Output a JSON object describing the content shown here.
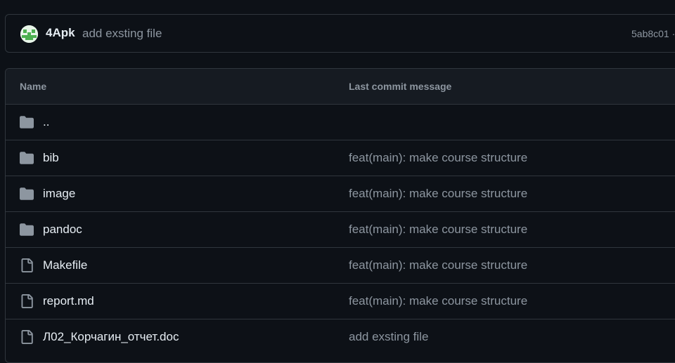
{
  "commit": {
    "author": "4Apk",
    "message": "add exsting file",
    "sha": "5ab8c01 ·"
  },
  "table": {
    "headers": {
      "name": "Name",
      "message": "Last commit message"
    },
    "rows": [
      {
        "type": "folder",
        "icon": "folder-icon",
        "name": "..",
        "message": ""
      },
      {
        "type": "folder",
        "icon": "folder-icon",
        "name": "bib",
        "message": "feat(main): make course structure"
      },
      {
        "type": "folder",
        "icon": "folder-icon",
        "name": "image",
        "message": "feat(main): make course structure"
      },
      {
        "type": "folder",
        "icon": "folder-icon",
        "name": "pandoc",
        "message": "feat(main): make course structure"
      },
      {
        "type": "file",
        "icon": "file-icon",
        "name": "Makefile",
        "message": "feat(main): make course structure"
      },
      {
        "type": "file",
        "icon": "file-icon",
        "name": "report.md",
        "message": "feat(main): make course structure"
      },
      {
        "type": "file",
        "icon": "file-icon",
        "name": "Л02_Корчагин_отчет.doc",
        "message": "add exsting file"
      }
    ]
  },
  "colors": {
    "background": "#0d1117",
    "header_background": "#161b22",
    "border": "#30363d",
    "text_primary": "#e6edf3",
    "text_muted": "#8d96a0",
    "icon": "#8d96a0"
  }
}
